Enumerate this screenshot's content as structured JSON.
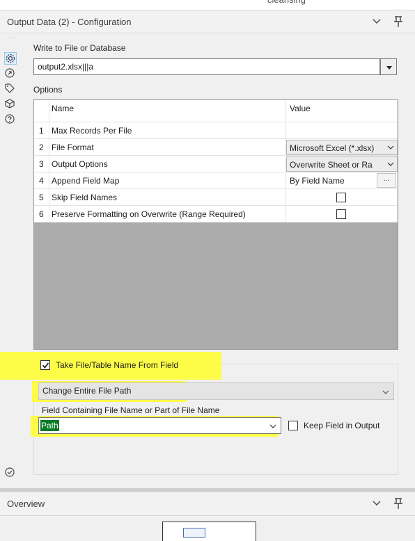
{
  "top_strip_text": "cleansing",
  "config_panel": {
    "title": "Output Data (2) - Configuration"
  },
  "write_section": {
    "label": "Write to File or Database",
    "value": "output2.xlsx|||a"
  },
  "options": {
    "label": "Options",
    "headers": {
      "name": "Name",
      "value": "Value"
    },
    "rows": [
      {
        "num": "1",
        "name": "Max Records Per File",
        "value": ""
      },
      {
        "num": "2",
        "name": "File Format",
        "value": "Microsoft Excel (*.xlsx)"
      },
      {
        "num": "3",
        "name": "Output Options",
        "value": "Overwrite Sheet or Ra"
      },
      {
        "num": "4",
        "name": "Append Field Map",
        "value": "By Field Name",
        "button": "..."
      },
      {
        "num": "5",
        "name": "Skip Field Names",
        "value": ""
      },
      {
        "num": "6",
        "name": "Preserve Formatting on Overwrite (Range Required)",
        "value": ""
      }
    ]
  },
  "take_from_field": {
    "label": "Take File/Table Name From Field",
    "checked": true,
    "mode": "Change Entire File Path",
    "field_label": "Field Containing File Name or Part of File Name",
    "field_value": "Path",
    "keep_label": "Keep Field in Output",
    "keep_checked": false
  },
  "overview_panel": {
    "title": "Overview"
  },
  "colors": {
    "highlight": "#ffff2a",
    "selection": "#0a7a27",
    "active_tab": "#dcecf9"
  }
}
